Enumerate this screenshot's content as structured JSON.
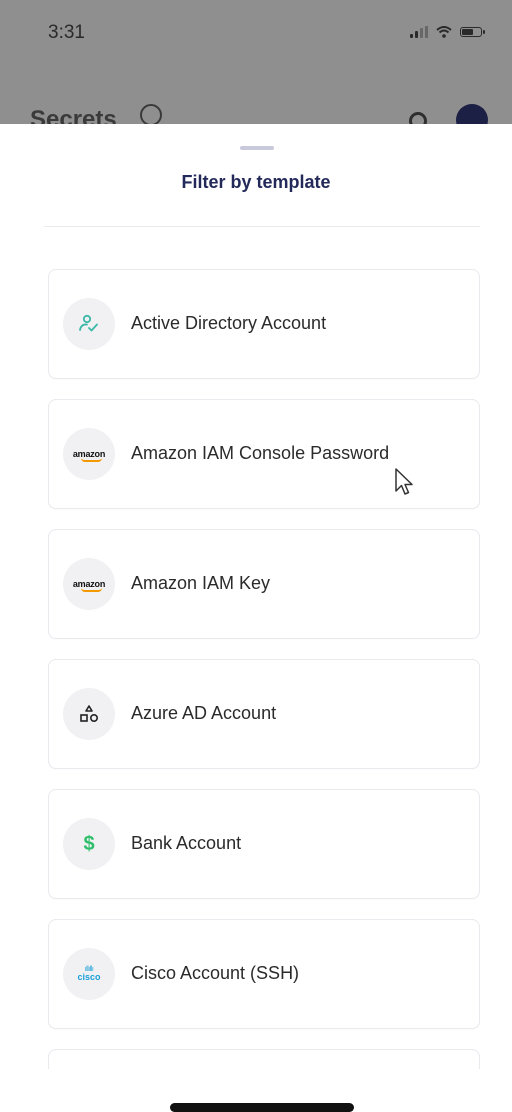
{
  "status_bar": {
    "time": "3:31"
  },
  "background_screen": {
    "title": "Secrets"
  },
  "sheet": {
    "title": "Filter by template",
    "items": [
      {
        "label": "Active Directory Account",
        "icon": "user-check-icon"
      },
      {
        "label": "Amazon IAM Console Password",
        "icon": "amazon-logo-icon",
        "icon_text": "amazon"
      },
      {
        "label": "Amazon IAM Key",
        "icon": "amazon-logo-icon",
        "icon_text": "amazon"
      },
      {
        "label": "Azure AD Account",
        "icon": "shapes-icon"
      },
      {
        "label": "Bank Account",
        "icon": "dollar-icon",
        "icon_text": "$"
      },
      {
        "label": "Cisco Account (SSH)",
        "icon": "cisco-logo-icon",
        "icon_text": "cisco"
      }
    ]
  },
  "colors": {
    "title": "#232a5a",
    "overlay": "#8f8f8f",
    "active_directory_icon": "#3cb8a8",
    "dollar_icon": "#2fbf6a",
    "amazon_smile": "#f29a00",
    "cisco": "#1ba0d7"
  }
}
